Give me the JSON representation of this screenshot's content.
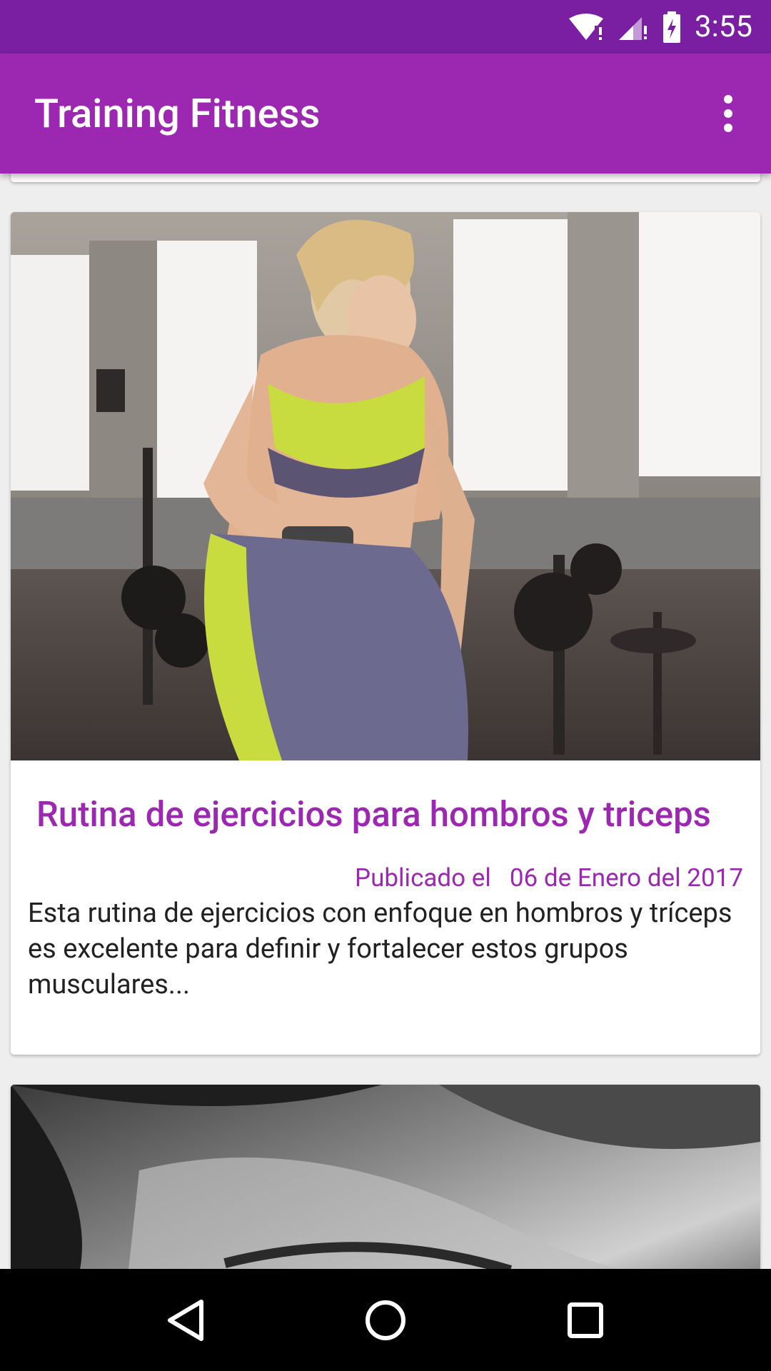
{
  "status_bar": {
    "time": "3:55",
    "icons": [
      "wifi-icon",
      "signal-icon",
      "battery-charging-icon"
    ]
  },
  "app_bar": {
    "title": "Training Fitness",
    "menu_icon": "overflow-menu-icon"
  },
  "feed": {
    "cards": [
      {
        "image": "woman-lifting-dumbbell-photo",
        "title": "Rutina de ejercicios para hombros y triceps",
        "published_label": "Publicado el",
        "date": "06 de Enero del 2017",
        "description": "Esta rutina de ejercicios con enfoque en hombros y tríceps es excelente para definir y fortalecer estos grupos musculares..."
      },
      {
        "image": "woman-portrait-bw-photo"
      }
    ]
  },
  "colors": {
    "status_bar": "#7b1fa2",
    "primary": "#9c27b0",
    "background": "#eeeeee"
  },
  "nav_bar": {
    "icons": [
      "back-icon",
      "home-icon",
      "recents-icon"
    ]
  }
}
